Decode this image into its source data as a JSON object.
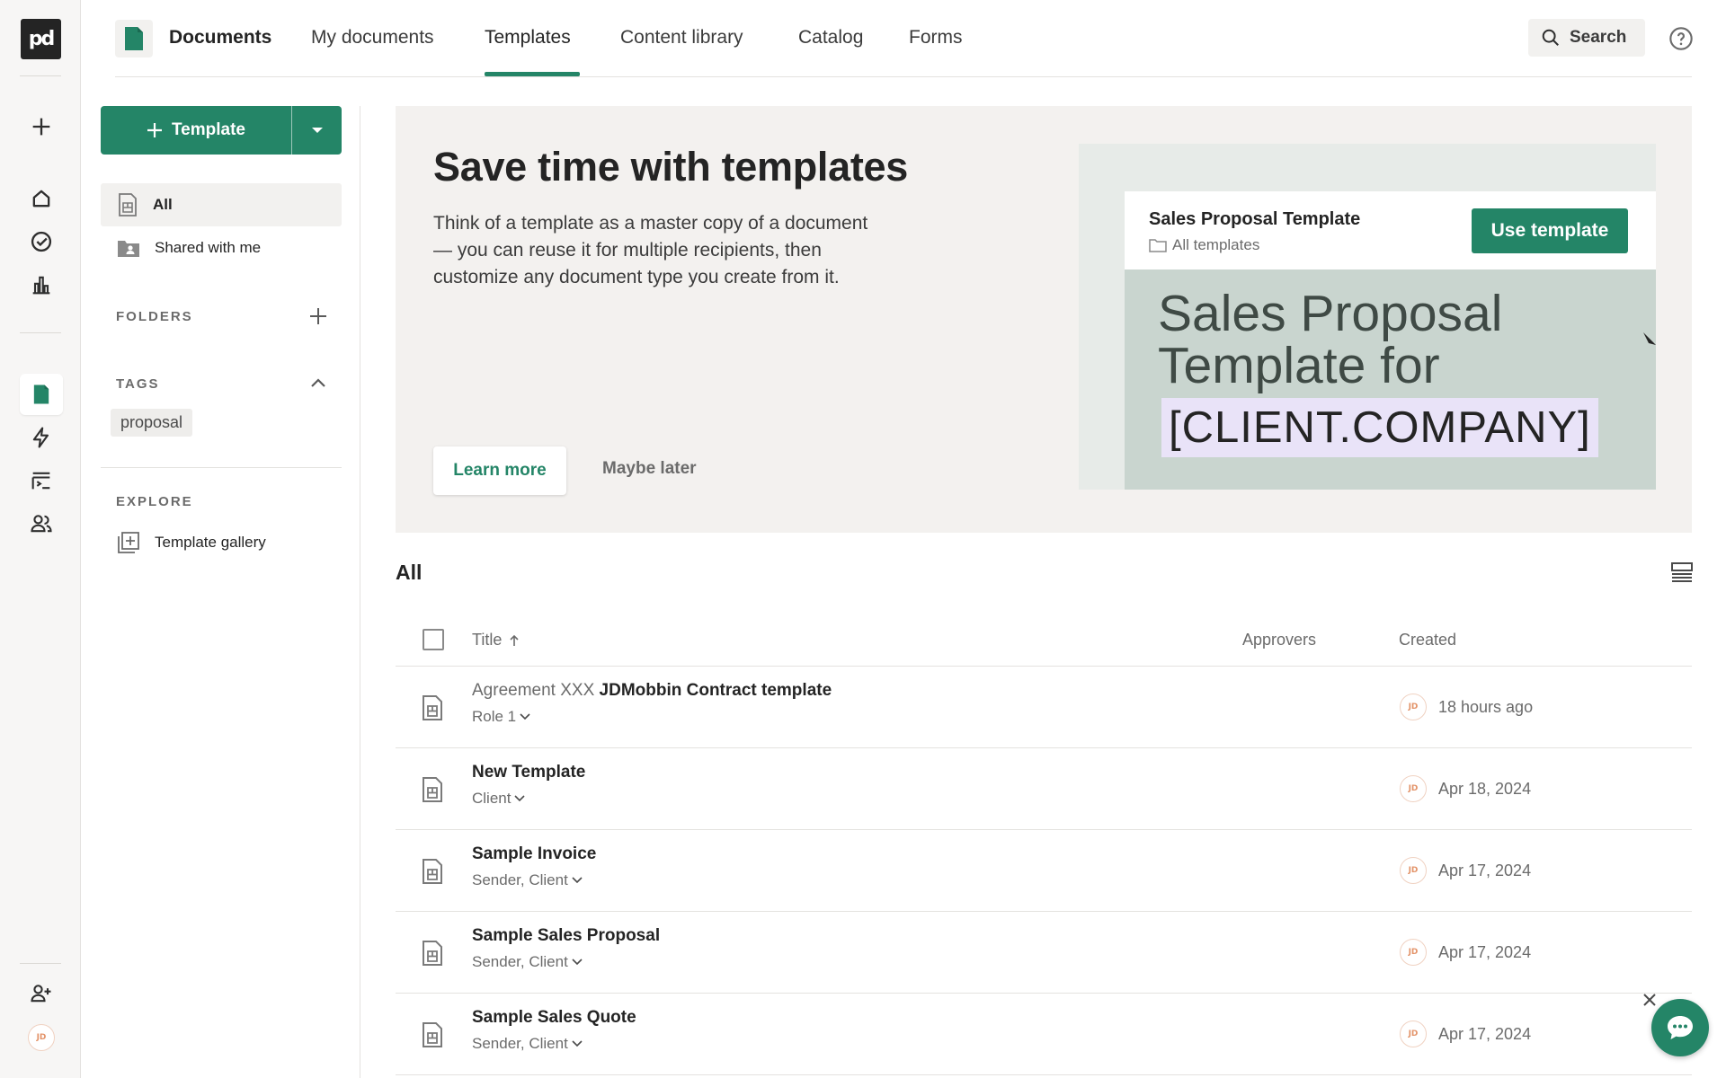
{
  "rail": {
    "logo_text": "pd",
    "avatar_initials": "JD"
  },
  "topnav": {
    "title": "Documents",
    "tabs": [
      "My documents",
      "Templates",
      "Content library",
      "Catalog",
      "Forms"
    ],
    "active_tab": "Templates",
    "search_label": "Search"
  },
  "sidebar": {
    "new_template_label": "Template",
    "items": [
      {
        "label": "All",
        "active": true
      },
      {
        "label": "Shared with me",
        "active": false
      }
    ],
    "folders_heading": "FOLDERS",
    "tags_heading": "TAGS",
    "tags": [
      "proposal"
    ],
    "explore_heading": "EXPLORE",
    "explore_items": [
      "Template gallery"
    ]
  },
  "banner": {
    "title": "Save time with templates",
    "body": "Think of a template as a master copy of a document — you can reuse it for multiple recipients, then customize any document type you create from it.",
    "learn_more": "Learn more",
    "maybe_later": "Maybe later",
    "preview": {
      "title": "Sales Proposal Template",
      "subtitle": "All templates",
      "use_button": "Use template",
      "big_line1": "Sales Proposal",
      "big_line2": "Template for",
      "client_token": "[CLIENT.COMPANY]"
    }
  },
  "list": {
    "title": "All",
    "columns": {
      "title": "Title",
      "approvers": "Approvers",
      "created": "Created"
    },
    "rows": [
      {
        "prefix": "Agreement XXX",
        "name": "JDMobbin Contract template",
        "roles": "Role 1",
        "avatar": "JD",
        "created": "18 hours ago"
      },
      {
        "prefix": "",
        "name": "New Template",
        "roles": "Client",
        "avatar": "JD",
        "created": "Apr 18, 2024"
      },
      {
        "prefix": "",
        "name": "Sample Invoice",
        "roles": "Sender, Client",
        "avatar": "JD",
        "created": "Apr 17, 2024"
      },
      {
        "prefix": "",
        "name": "Sample Sales Proposal",
        "roles": "Sender, Client",
        "avatar": "JD",
        "created": "Apr 17, 2024"
      },
      {
        "prefix": "",
        "name": "Sample Sales Quote",
        "roles": "Sender, Client",
        "avatar": "JD",
        "created": "Apr 17, 2024"
      }
    ]
  },
  "colors": {
    "brand_green": "#248567",
    "rail_bg": "#f7f6f5",
    "banner_bg": "#f3f1ef",
    "token_bg": "#e9e3f8"
  }
}
